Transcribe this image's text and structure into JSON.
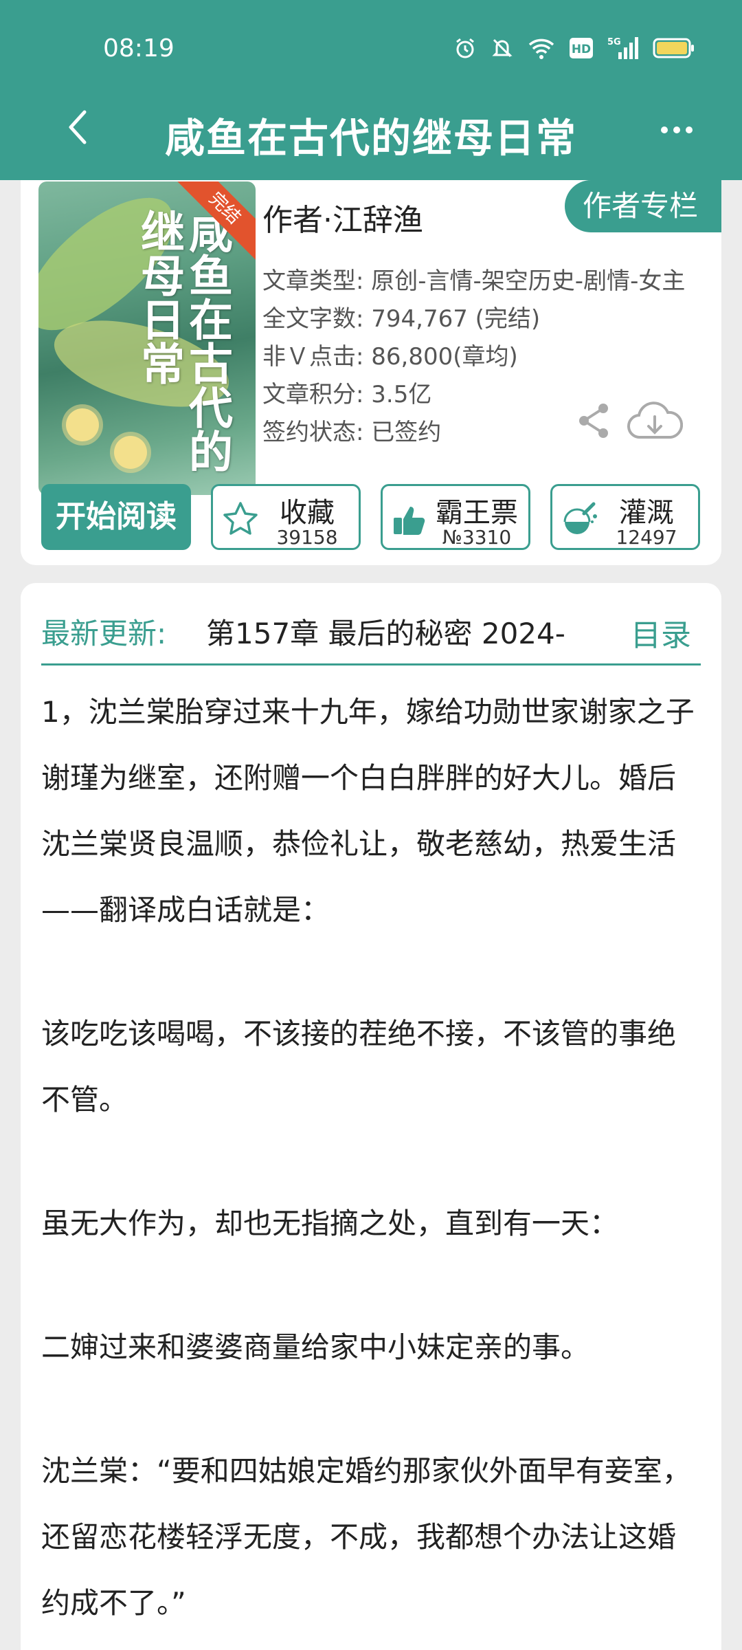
{
  "status_bar": {
    "time": "08:19",
    "icons": [
      "alarm-icon",
      "mute-icon",
      "wifi-icon",
      "hd-icon",
      "5g-signal-icon",
      "battery-icon"
    ],
    "hd_label": "HD",
    "net_label": "5G"
  },
  "header": {
    "title": "咸鱼在古代的继母日常",
    "back_icon": "chevron-left-icon",
    "more_icon": "more-dots-icon"
  },
  "book": {
    "cover_title": "咸鱼在古代的继母日常",
    "cover_badge": "完结",
    "author": "作者·江辞渔",
    "author_column_button": "作者专栏",
    "meta": {
      "genre": "文章类型: 原创-言情-架空历史-剧情-女主",
      "word_count": "全文字数: 794,767 (完结)",
      "clicks": "非Ｖ点击: 86,800(章均)",
      "score": "文章积分: 3.5亿",
      "contract": "签约状态: 已签约"
    }
  },
  "actions": {
    "read_button": "开始阅读",
    "favorite": {
      "label": "收藏",
      "count": "39158"
    },
    "bawang": {
      "label": "霸王票",
      "count": "№3310"
    },
    "irrigate": {
      "label": "灌溉",
      "count": "12497"
    }
  },
  "latest": {
    "label": "最新更新:",
    "chapter": "第157章  最后的秘密  2024-",
    "catalog": "目录"
  },
  "synopsis": {
    "p1": "1，沈兰棠胎穿过来十九年，嫁给功勋世家谢家之子谢瑾为继室，还附赠一个白白胖胖的好大儿。婚后沈兰棠贤良温顺，恭俭礼让，敬老慈幼，热爱生活——翻译成白话就是：",
    "p2": "该吃吃该喝喝，不该接的茬绝不接，不该管的事绝不管。",
    "p3": "虽无大作为，却也无指摘之处，直到有一天：",
    "p4": "二婶过来和婆婆商量给家中小妹定亲的事。",
    "p5": "沈兰棠：“要和四姑娘定婚约那家伙外面早有妾室，还留恋花楼轻浮无度，不成，我都想个办法让这婚约成不了。”"
  },
  "colors": {
    "accent": "#3a9e8f",
    "background": "#ececec",
    "card": "#ffffff"
  }
}
